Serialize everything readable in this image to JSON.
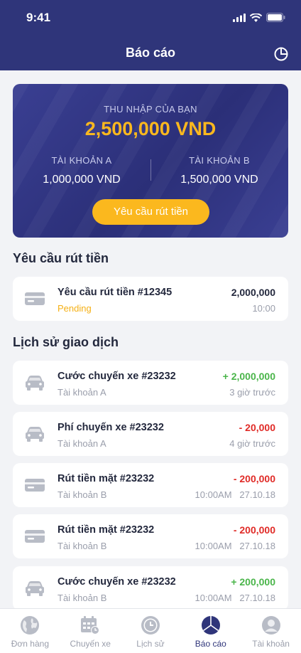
{
  "status_bar": {
    "time": "9:41"
  },
  "header": {
    "title": "Báo cáo",
    "action_icon": "pie-chart-icon"
  },
  "summary": {
    "income_label": "THU NHẬP CỦA BẠN",
    "income_value": "2,500,000 VND",
    "account_a": {
      "label": "TÀI KHOẢN A",
      "value": "1,000,000 VND"
    },
    "account_b": {
      "label": "TÀI KHOẢN B",
      "value": "1,500,000 VND"
    },
    "withdraw_button": "Yêu cầu rút tiền"
  },
  "withdraw_section": {
    "title": "Yêu cầu rút tiền",
    "items": [
      {
        "name": "Yêu cầu rút tiền #12345",
        "status": "Pending",
        "amount": "2,000,000",
        "time": "10:00",
        "icon": "card-icon"
      }
    ]
  },
  "history_section": {
    "title": "Lịch sử giao dịch",
    "items": [
      {
        "name": "Cước chuyến xe #23232",
        "account": "Tài khoản A",
        "amount": "+ 2,000,000",
        "time": "3 giờ trước",
        "icon": "car-icon"
      },
      {
        "name": "Phí chuyến xe #23232",
        "account": "Tài khoản A",
        "amount": "- 20,000",
        "time": "4 giờ trước",
        "icon": "car-icon"
      },
      {
        "name": "Rút tiền mặt #23232",
        "account": "Tài khoản B",
        "amount": "- 200,000",
        "time": "10:00AM   27.10.18",
        "icon": "card-icon"
      },
      {
        "name": "Rút tiền mặt #23232",
        "account": "Tài khoản B",
        "amount": "- 200,000",
        "time": "10:00AM   27.10.18",
        "icon": "card-icon"
      },
      {
        "name": "Cước chuyến xe #23232",
        "account": "Tài khoản B",
        "amount": "+ 200,000",
        "time": "10:00AM   27.10.18",
        "icon": "car-icon"
      }
    ]
  },
  "tabs": [
    {
      "label": "Đơn hàng",
      "icon": "globe-icon",
      "active": false
    },
    {
      "label": "Chuyến xe",
      "icon": "calendar-icon",
      "active": false
    },
    {
      "label": "Lịch sử",
      "icon": "clock-icon",
      "active": false
    },
    {
      "label": "Báo cáo",
      "icon": "pie-chart-icon",
      "active": true
    },
    {
      "label": "Tài khoản",
      "icon": "user-icon",
      "active": false
    }
  ],
  "colors": {
    "primary": "#2f357a",
    "accent": "#fbb81e",
    "positive": "#4ab54a",
    "negative": "#e02b27",
    "pending": "#f5b015"
  }
}
